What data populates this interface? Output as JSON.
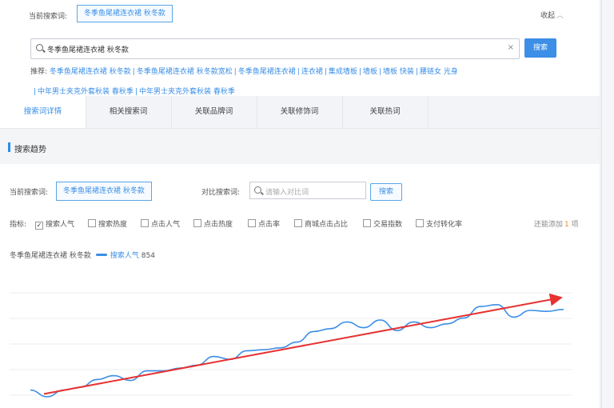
{
  "top": {
    "current_label": "当前搜索词:",
    "current_keyword": "冬季鱼尾裙连衣裙 秋冬款",
    "collapse_label": "收起",
    "search_value": "冬季鱼尾裙连衣裙 秋冬款",
    "search_button": "搜索",
    "recommend_label": "推荐:",
    "recommend_items": [
      "冬季鱼尾裙连衣裙 秋冬款",
      "冬季鱼尾裙连衣裙 秋冬款宽松",
      "冬季鱼尾裙连衣裙",
      "连衣裙",
      "集成墙板",
      "墙板",
      "墙板 快装",
      "腰链女 光身"
    ],
    "recommend_items_2": [
      "中年男士夹克外套秋装 春秋季",
      "中年男士夹克外套秋装 春秋季"
    ]
  },
  "tabs": [
    "搜索词详情",
    "相关搜索词",
    "关联品牌词",
    "关联修饰词",
    "关联热词"
  ],
  "section_title": "搜索趋势",
  "compare": {
    "current_label": "当前搜索词:",
    "current_keyword": "冬季鱼尾裙连衣裙 秋冬款",
    "compare_label": "对比搜索词:",
    "placeholder": "请输入对比词",
    "button": "搜索"
  },
  "metrics": {
    "label": "指标:",
    "items": [
      {
        "label": "搜索人气",
        "checked": true
      },
      {
        "label": "搜索热度",
        "checked": false
      },
      {
        "label": "点击人气",
        "checked": false
      },
      {
        "label": "点击热度",
        "checked": false
      },
      {
        "label": "点击率",
        "checked": false
      },
      {
        "label": "商城点击占比",
        "checked": false
      },
      {
        "label": "交易指数",
        "checked": false
      },
      {
        "label": "支付转化率",
        "checked": false
      }
    ],
    "added_label": "还能添加",
    "added_count": "1",
    "added_unit": "项"
  },
  "legend": {
    "keyword": "冬季鱼尾裙连衣裙 秋冬款",
    "series_name": "搜索人气",
    "series_value": "854"
  },
  "colors": {
    "accent": "#3c8ee6",
    "trend": "#e63232",
    "line": "#3c8ee6"
  },
  "chart_data": {
    "type": "line",
    "y_ticks": [
      "",
      "",
      "",
      "",
      ""
    ],
    "series": [
      {
        "name": "搜索人气",
        "values": [
          12,
          5,
          12,
          15,
          23,
          27,
          22,
          32,
          32,
          35,
          38,
          47,
          44,
          53,
          54,
          56,
          62,
          73,
          76,
          83,
          77,
          85,
          74,
          83,
          77,
          81,
          87,
          99,
          101,
          88,
          95,
          94,
          96
        ]
      }
    ],
    "trend_line": {
      "start": 8,
      "end": 108
    },
    "ylim": [
      0,
      120
    ]
  }
}
